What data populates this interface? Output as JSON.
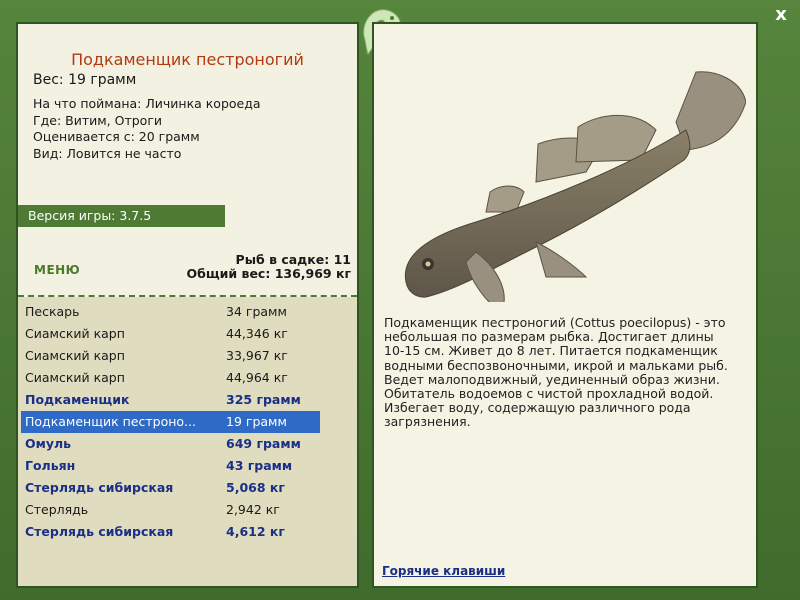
{
  "close_label": "x",
  "fish": {
    "title": "Подкаменщик пестроногий",
    "weight": "Вес: 19 грамм",
    "caught_on": "На что поймана: Личинка короеда",
    "where": "Где: Витим, Отроги",
    "valued_from": "Оценивается с: 20 грамм",
    "kind": "Вид: Ловится не часто",
    "description": "Подкаменщик пестроногий (Cottus poecilopus) - это небольшая по размерам рыбка. Достигает длины 10-15 см. Живет до 8 лет. Питается подкаменщик водными беспозвоночными, икрой и мальками рыб. Ведет малоподвижный, уединенный образ жизни. Обитатель водоемов с чистой прохладной водой. Избегает воду, содержащую различного рода загрязнения."
  },
  "game_version": "Версия игры: 3.7.5",
  "menu_label": "МЕНЮ",
  "stats": {
    "fish_in_keepnet": "Рыб в садке: 11",
    "total_weight": "Общий вес: 136,969 кг"
  },
  "catch_list": [
    {
      "name": "Пескарь",
      "weight": "34 грамм",
      "bold": false,
      "selected": false
    },
    {
      "name": "Сиамский карп",
      "weight": "44,346 кг",
      "bold": false,
      "selected": false
    },
    {
      "name": "Сиамский карп",
      "weight": "33,967 кг",
      "bold": false,
      "selected": false
    },
    {
      "name": "Сиамский карп",
      "weight": "44,964 кг",
      "bold": false,
      "selected": false
    },
    {
      "name": "Подкаменщик",
      "weight": "325 грамм",
      "bold": true,
      "selected": false
    },
    {
      "name": "Подкаменщик пестроно...",
      "weight": "19 грамм",
      "bold": false,
      "selected": true
    },
    {
      "name": "Омуль",
      "weight": "649 грамм",
      "bold": true,
      "selected": false
    },
    {
      "name": "Гольян",
      "weight": "43 грамм",
      "bold": true,
      "selected": false
    },
    {
      "name": "Стерлядь сибирская",
      "weight": "5,068 кг",
      "bold": true,
      "selected": false
    },
    {
      "name": "Стерлядь",
      "weight": "2,942 кг",
      "bold": false,
      "selected": false
    },
    {
      "name": "Стерлядь сибирская",
      "weight": "4,612 кг",
      "bold": true,
      "selected": false
    }
  ],
  "hotkeys_label": "Горячие клавиши",
  "colors": {
    "frame": "#4b7a35",
    "panel": "#f2f1e2",
    "title": "#b23a0e",
    "list_bold": "#1b2f86",
    "selection": "#2f6ac6"
  }
}
